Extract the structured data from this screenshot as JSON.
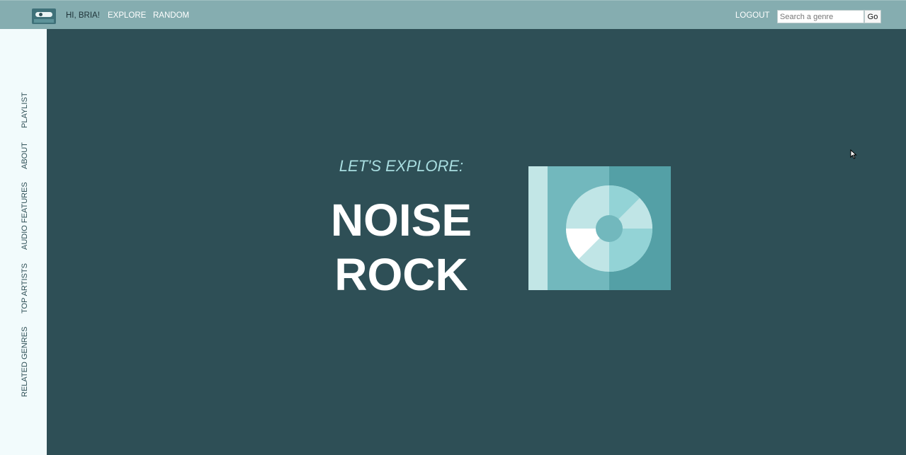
{
  "topbar": {
    "greeting": "HI, BRIA!",
    "nav": [
      {
        "label": "EXPLORE"
      },
      {
        "label": "RANDOM"
      }
    ],
    "logout_label": "LOGOUT",
    "search": {
      "placeholder": "Search a genre",
      "value": ""
    },
    "go_label": "Go"
  },
  "sidebar": {
    "items": [
      {
        "label": "PLAYLIST"
      },
      {
        "label": "ABOUT"
      },
      {
        "label": "AUDIO FEATURES"
      },
      {
        "label": "TOP ARTISTS"
      },
      {
        "label": "RELATED GENRES"
      }
    ]
  },
  "main": {
    "subtitle": "LET'S EXPLORE:",
    "genre_line1": "NOISE",
    "genre_line2": "ROCK"
  },
  "icons": {
    "logo": "cassette-icon",
    "album": "cd-case-icon",
    "cursor": "mouse-pointer-icon"
  },
  "colors": {
    "topbar": "#85adb0",
    "main_bg": "#2e4f56",
    "sidebar_bg": "#f2fbfc",
    "accent": "#a8dde0"
  }
}
